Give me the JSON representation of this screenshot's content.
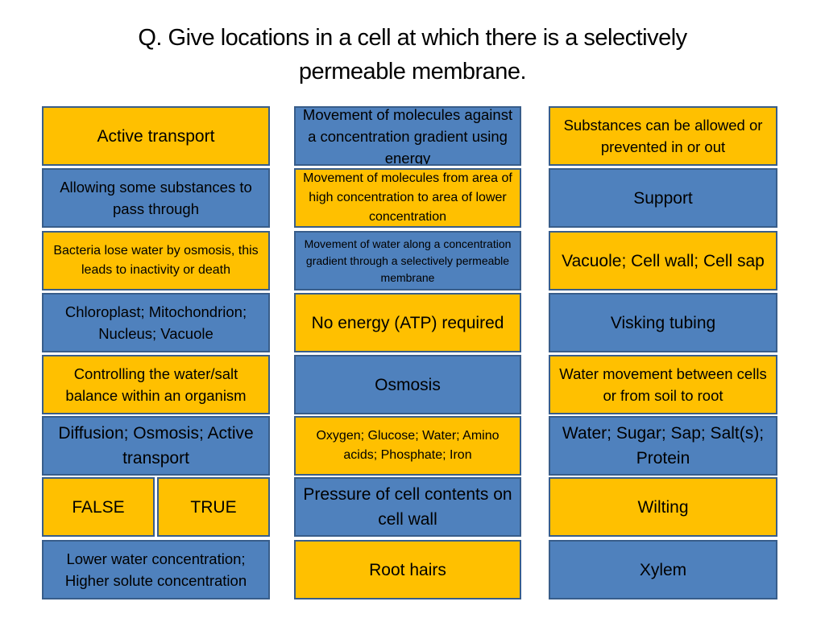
{
  "slide": {
    "title_line1": "Q. Give locations in a cell at which there is a selectively",
    "title_line2": "permeable membrane.",
    "colors": {
      "gold": "#FFC000",
      "blue": "#4F81BD",
      "border": "#385D8A"
    }
  },
  "column1": [
    {
      "text": "Active transport",
      "color": "gold"
    },
    {
      "text": "Allowing some substances to pass through",
      "color": "blue"
    },
    {
      "text": "Bacteria lose water by osmosis, this leads to inactivity or death",
      "color": "gold"
    },
    {
      "text": "Chloroplast; Mitochondrion; Nucleus; Vacuole",
      "color": "blue"
    },
    {
      "text": "Controlling the water/salt balance within an organism",
      "color": "gold"
    },
    {
      "text": "Diffusion; Osmosis; Active transport",
      "color": "blue"
    },
    {
      "text_a": "FALSE",
      "text_b": "TRUE",
      "color": "gold"
    },
    {
      "text": "Lower water concentration; Higher solute concentration",
      "color": "blue"
    }
  ],
  "column2": [
    {
      "text": "Movement of molecules against a concentration gradient using energy",
      "color": "blue"
    },
    {
      "text": "Movement of molecules from area of high concentration to area of lower concentration",
      "color": "gold"
    },
    {
      "text": "Movement of water along a concentration gradient through a selectively permeable membrane",
      "color": "blue"
    },
    {
      "text": "No energy (ATP) required",
      "color": "gold"
    },
    {
      "text": "Osmosis",
      "color": "blue"
    },
    {
      "text": "Oxygen; Glucose; Water; Amino acids; Phosphate; Iron",
      "color": "gold"
    },
    {
      "text": "Pressure of cell contents on cell wall",
      "color": "blue"
    },
    {
      "text": "Root hairs",
      "color": "gold"
    }
  ],
  "column3": [
    {
      "text": "Substances can be allowed or prevented in or out",
      "color": "gold"
    },
    {
      "text": "Support",
      "color": "blue"
    },
    {
      "text": "Vacuole; Cell wall; Cell sap",
      "color": "gold"
    },
    {
      "text": "Visking tubing",
      "color": "blue"
    },
    {
      "text": "Water movement between cells or from soil to root",
      "color": "gold"
    },
    {
      "text": "Water; Sugar; Sap; Salt(s); Protein",
      "color": "blue"
    },
    {
      "text": "Wilting",
      "color": "gold"
    },
    {
      "text": "Xylem",
      "color": "blue"
    }
  ]
}
